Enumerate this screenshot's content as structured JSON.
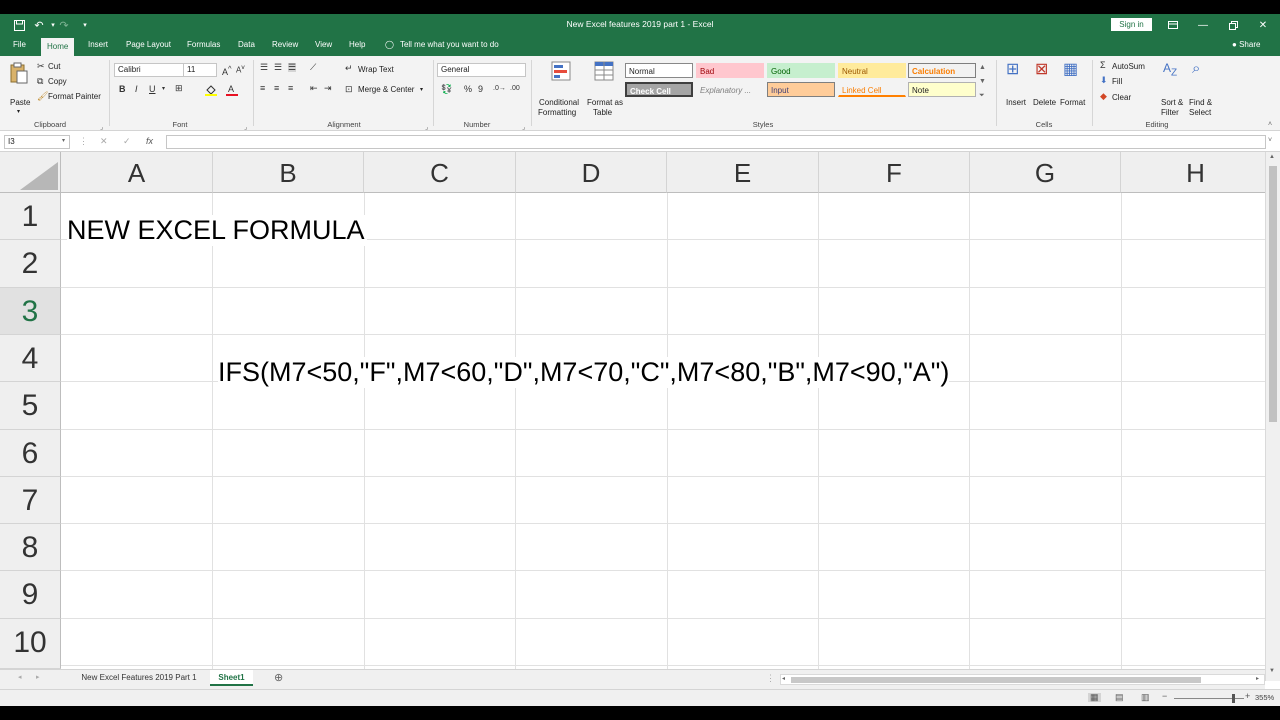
{
  "window": {
    "title": "New Excel features 2019 part 1  -  Excel",
    "sign_in": "Sign in",
    "accent": "#217346"
  },
  "tabs": [
    "File",
    "Home",
    "Insert",
    "Page Layout",
    "Formulas",
    "Data",
    "Review",
    "View",
    "Help"
  ],
  "tell_me": "Tell me what you want to do",
  "share": "Share",
  "ribbon": {
    "clipboard": {
      "paste": "Paste",
      "cut": "Cut",
      "copy": "Copy",
      "format_painter": "Format Painter",
      "label": "Clipboard"
    },
    "font": {
      "name": "Calibri",
      "size": "11",
      "bold": "B",
      "italic": "I",
      "underline": "U",
      "label": "Font"
    },
    "alignment": {
      "wrap_text": "Wrap Text",
      "merge_center": "Merge & Center",
      "label": "Alignment"
    },
    "number": {
      "format": "General",
      "percent": "%",
      "comma": "9",
      "label": "Number"
    },
    "styles": {
      "conditional_formatting_1": "Conditional",
      "conditional_formatting_2": "Formatting",
      "format_as_table_1": "Format as",
      "format_as_table_2": "Table",
      "normal": "Normal",
      "bad": "Bad",
      "good": "Good",
      "neutral": "Neutral",
      "calculation": "Calculation",
      "check_cell": "Check Cell",
      "explanatory": "Explanatory ...",
      "input": "Input",
      "linked_cell": "Linked Cell",
      "note": "Note",
      "label": "Styles"
    },
    "cells": {
      "insert": "Insert",
      "delete": "Delete",
      "format": "Format",
      "label": "Cells"
    },
    "editing": {
      "autosum": "AutoSum",
      "fill": "Fill",
      "clear": "Clear",
      "sort_1": "Sort &",
      "sort_2": "Filter",
      "find_1": "Find &",
      "find_2": "Select",
      "label": "Editing"
    }
  },
  "formula_bar": {
    "name_box": "I3",
    "formula": ""
  },
  "grid": {
    "columns": [
      "A",
      "B",
      "C",
      "D",
      "E",
      "F",
      "G",
      "H"
    ],
    "rows": [
      "1",
      "2",
      "3",
      "4",
      "5",
      "6",
      "7",
      "8",
      "9",
      "10"
    ],
    "active_row": "3",
    "cells": {
      "A1": "NEW EXCEL FORMULA",
      "B4": "IFS(M7<50,\"F\",M7<60,\"D\",M7<70,\"C\",M7<80,\"B\",M7<90,\"A\")"
    }
  },
  "sheets": [
    "New Excel Features 2019 Part 1",
    "Sheet1"
  ],
  "active_sheet": "Sheet1",
  "zoom": "355%"
}
